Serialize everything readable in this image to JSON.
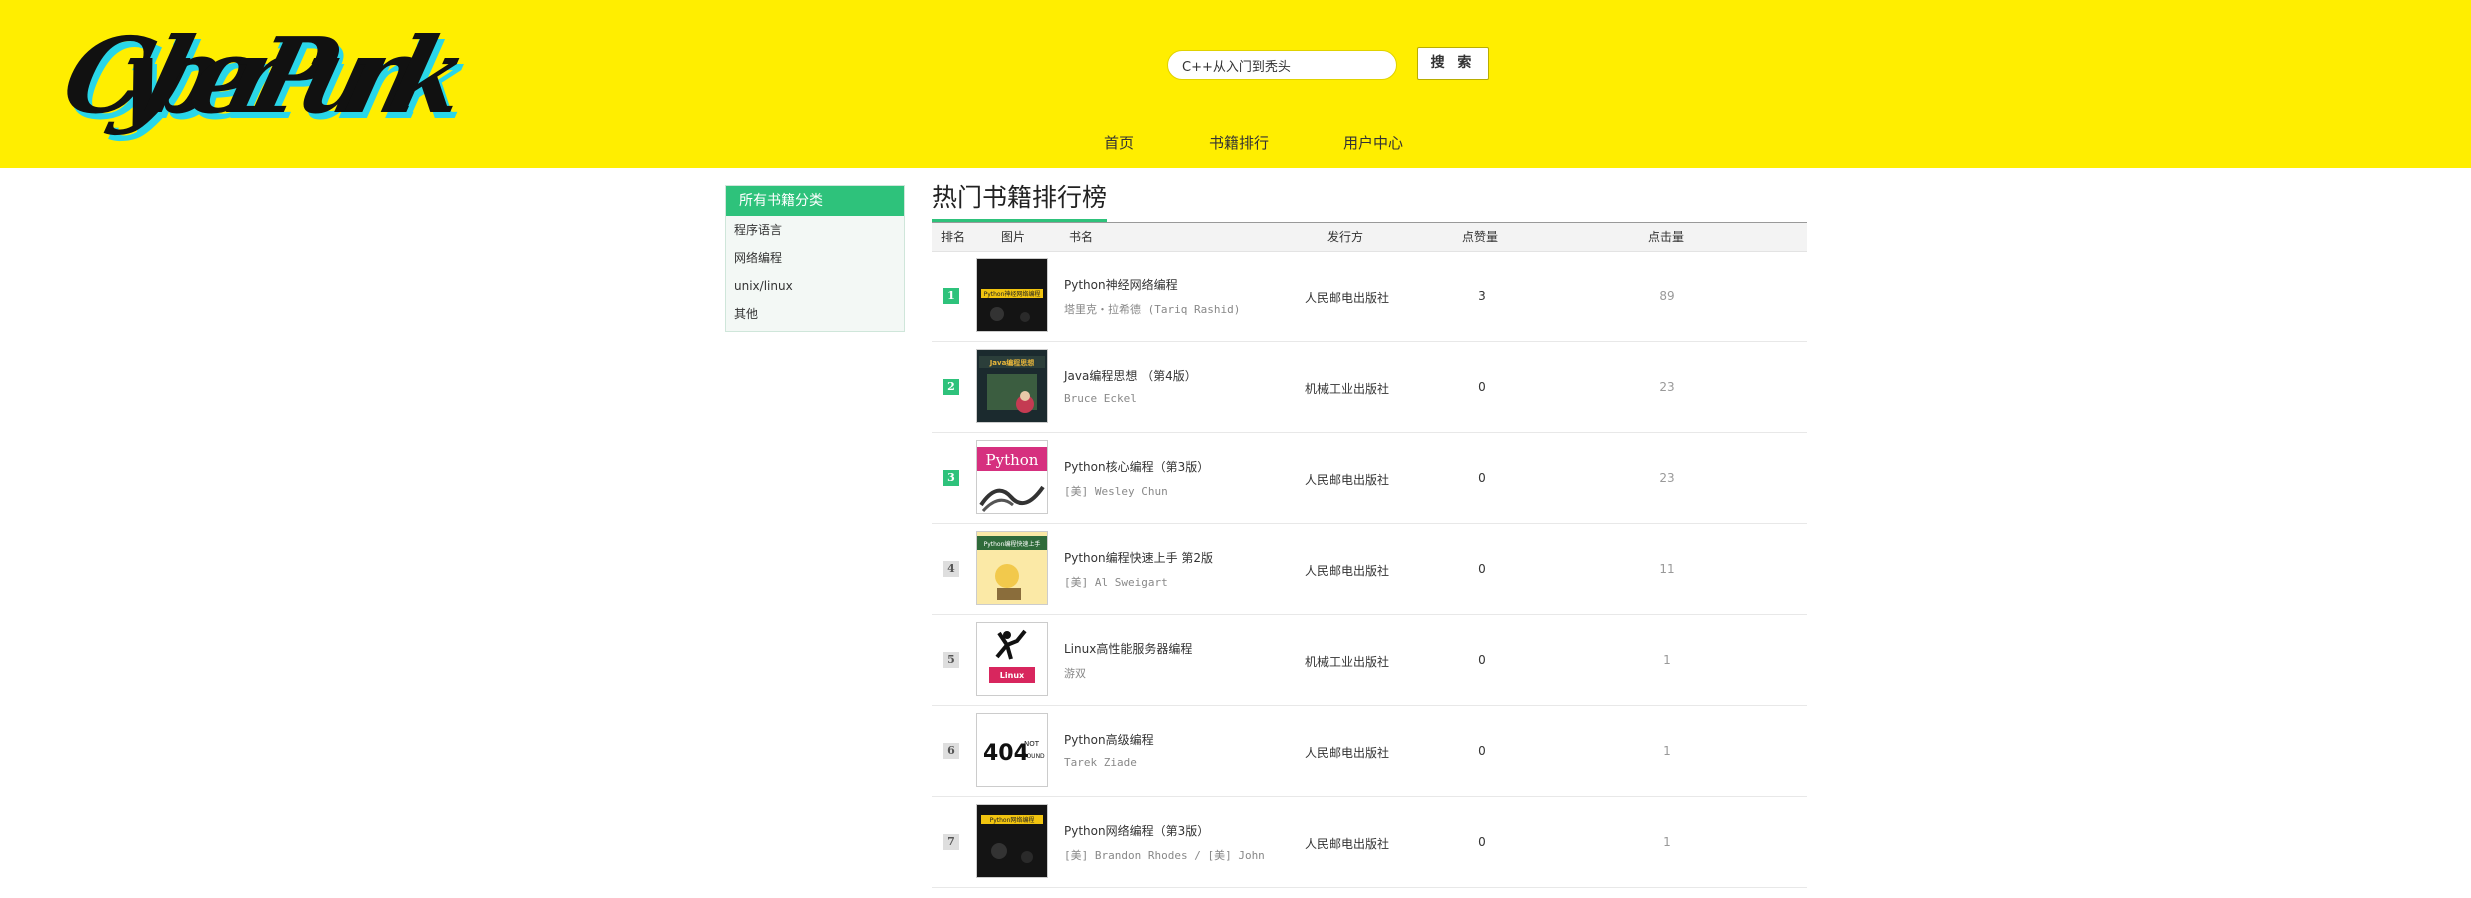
{
  "header": {
    "logo_text": "CyberPunk",
    "search": {
      "value": "C++从入门到秃头",
      "placeholder": ""
    },
    "search_button": "搜 索",
    "nav": [
      "首页",
      "书籍排行",
      "用户中心"
    ]
  },
  "sidebar": {
    "title": "所有书籍分类",
    "items": [
      "程序语言",
      "网络编程",
      "unix/linux",
      "其他"
    ]
  },
  "main": {
    "title": "热门书籍排行榜",
    "columns": [
      "排名",
      "图片",
      "书名",
      "发行方",
      "点赞量",
      "点击量"
    ],
    "books": [
      {
        "rank": "1",
        "title": "Python神经网络编程",
        "author": "塔里克・拉希德 (Tariq Rashid)",
        "publisher": "人民邮电出版社",
        "likes": "3",
        "clicks": "89",
        "cover": "python-nn-cover"
      },
      {
        "rank": "2",
        "title": "Java编程思想 （第4版）",
        "author": "Bruce Eckel",
        "publisher": "机械工业出版社",
        "likes": "0",
        "clicks": "23",
        "cover": "java-thinking-cover"
      },
      {
        "rank": "3",
        "title": "Python核心编程（第3版）",
        "author": "[美] Wesley Chun",
        "publisher": "人民邮电出版社",
        "likes": "0",
        "clicks": "23",
        "cover": "python-core-cover"
      },
      {
        "rank": "4",
        "title": "Python编程快速上手 第2版",
        "author": "[美] Al Sweigart",
        "publisher": "人民邮电出版社",
        "likes": "0",
        "clicks": "11",
        "cover": "python-quick-cover"
      },
      {
        "rank": "5",
        "title": "Linux高性能服务器编程",
        "author": "游双",
        "publisher": "机械工业出版社",
        "likes": "0",
        "clicks": "1",
        "cover": "linux-server-cover"
      },
      {
        "rank": "6",
        "title": "Python高级编程",
        "author": "Tarek Ziade",
        "publisher": "人民邮电出版社",
        "likes": "0",
        "clicks": "1",
        "cover": "404-not-found-cover"
      },
      {
        "rank": "7",
        "title": "Python网络编程（第3版）",
        "author": "[美] Brandon Rhodes  /  [美] John",
        "publisher": "人民邮电出版社",
        "likes": "0",
        "clicks": "1",
        "cover": "python-network-cover"
      }
    ]
  },
  "cover_texts": {
    "python_nn": "Python神经网络编程",
    "java": "Java编程思想",
    "python_core": "Python",
    "python_quick": "Python编程快速上手",
    "linux": "Linux",
    "not_found_code": "404",
    "not_found_word1": "NOT",
    "not_found_word2": "FOUND",
    "python_net": "Python网络编程"
  },
  "colors": {
    "header_bg": "#ffee00",
    "accent": "#2ec27b",
    "rank_top": "#2ec27b",
    "rank_normal": "#dedede"
  }
}
